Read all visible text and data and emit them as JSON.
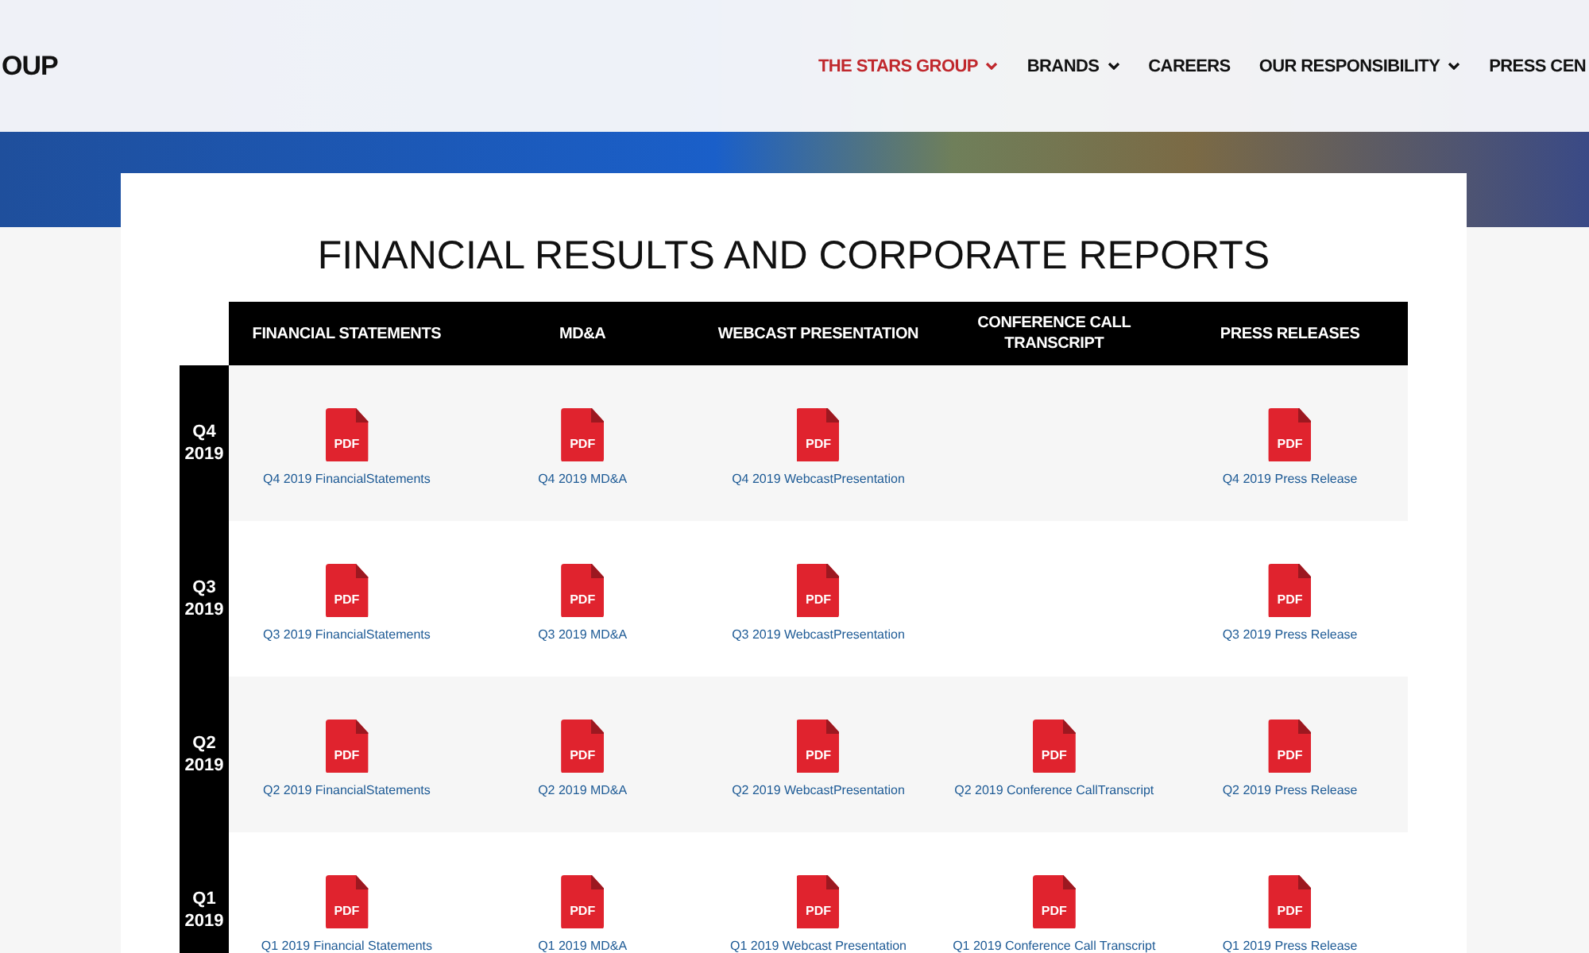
{
  "header": {
    "logo": "OUP",
    "nav": [
      {
        "label": "THE STARS GROUP",
        "selected": true,
        "dropdown": true
      },
      {
        "label": "BRANDS",
        "selected": false,
        "dropdown": true
      },
      {
        "label": "CAREERS",
        "selected": false,
        "dropdown": false
      },
      {
        "label": "OUR RESPONSIBILITY",
        "selected": false,
        "dropdown": true
      },
      {
        "label": "PRESS CEN",
        "selected": false,
        "dropdown": false
      }
    ]
  },
  "page_title": "FINANCIAL RESULTS AND CORPORATE REPORTS",
  "table": {
    "columns": [
      "FINANCIAL STATEMENTS",
      "MD&A",
      "WEBCAST PRESENTATION",
      "CONFERENCE CALL TRANSCRIPT",
      "PRESS RELEASES"
    ],
    "rows": [
      {
        "quarter": "Q4",
        "year": "2019",
        "cells": [
          {
            "kind": "pdf",
            "icon_text": "PDF",
            "label": "Q4 2019 FinancialStatements"
          },
          {
            "kind": "pdf",
            "icon_text": "PDF",
            "label": "Q4 2019 MD&A"
          },
          {
            "kind": "pdf",
            "icon_text": "PDF",
            "label": "Q4 2019 WebcastPresentation"
          },
          {
            "kind": "empty"
          },
          {
            "kind": "pdf",
            "icon_text": "PDF",
            "label": "Q4 2019 Press Release"
          }
        ]
      },
      {
        "quarter": "Q3",
        "year": "2019",
        "cells": [
          {
            "kind": "pdf",
            "icon_text": "PDF",
            "label": "Q3 2019 FinancialStatements"
          },
          {
            "kind": "pdf",
            "icon_text": "PDF",
            "label": "Q3 2019 MD&A"
          },
          {
            "kind": "pdf",
            "icon_text": "PDF",
            "label": "Q3 2019 WebcastPresentation"
          },
          {
            "kind": "empty"
          },
          {
            "kind": "pdf",
            "icon_text": "PDF",
            "label": "Q3 2019 Press Release"
          }
        ]
      },
      {
        "quarter": "Q2",
        "year": "2019",
        "cells": [
          {
            "kind": "pdf",
            "icon_text": "PDF",
            "label": "Q2 2019 FinancialStatements"
          },
          {
            "kind": "pdf",
            "icon_text": "PDF",
            "label": "Q2 2019 MD&A"
          },
          {
            "kind": "pdf",
            "icon_text": "PDF",
            "label": "Q2 2019 WebcastPresentation"
          },
          {
            "kind": "pdf",
            "icon_text": "PDF",
            "label": "Q2 2019 Conference CallTranscript"
          },
          {
            "kind": "pdf",
            "icon_text": "PDF",
            "label": "Q2 2019 Press Release"
          }
        ]
      },
      {
        "quarter": "Q1",
        "year": "2019",
        "cells": [
          {
            "kind": "pdf",
            "icon_text": "PDF",
            "label": "Q1 2019 Financial Statements"
          },
          {
            "kind": "pdf",
            "icon_text": "PDF",
            "label": "Q1 2019 MD&A"
          },
          {
            "kind": "pdf",
            "icon_text": "PDF",
            "label": "Q1 2019 Webcast Presentation"
          },
          {
            "kind": "pdf",
            "icon_text": "PDF",
            "label": "Q1 2019 Conference Call Transcript"
          },
          {
            "kind": "pdf",
            "icon_text": "PDF",
            "label": "Q1 2019 Press Release"
          }
        ]
      }
    ]
  }
}
